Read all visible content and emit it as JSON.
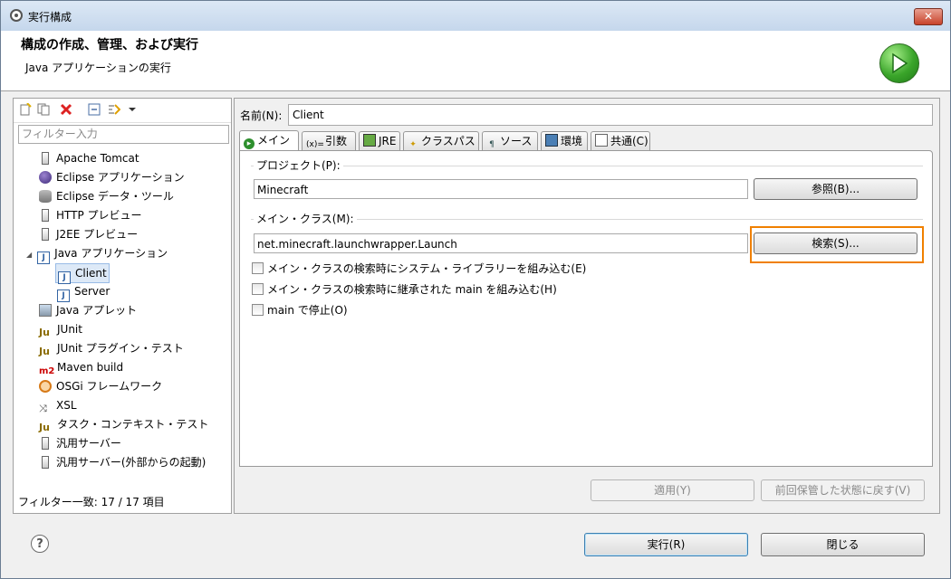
{
  "window": {
    "title": "実行構成",
    "close_label": "✕"
  },
  "header": {
    "title": "構成の作成、管理、および実行",
    "subtitle": "Java アプリケーションの実行"
  },
  "left": {
    "filter_placeholder": "フィルター入力",
    "tree": [
      {
        "label": "Apache Tomcat",
        "icon": "server-icon"
      },
      {
        "label": "Eclipse アプリケーション",
        "icon": "eclipse-icon"
      },
      {
        "label": "Eclipse データ・ツール",
        "icon": "database-icon"
      },
      {
        "label": "HTTP プレビュー",
        "icon": "server-icon"
      },
      {
        "label": "J2EE プレビュー",
        "icon": "server-icon"
      },
      {
        "label": "Java アプリケーション",
        "icon": "java-app-icon"
      },
      {
        "label": "Client",
        "icon": "java-app-icon"
      },
      {
        "label": "Server",
        "icon": "java-app-icon"
      },
      {
        "label": "Java アプレット",
        "icon": "applet-icon"
      },
      {
        "label": "JUnit",
        "icon": "junit-icon"
      },
      {
        "label": "JUnit プラグイン・テスト",
        "icon": "junit-plugin-icon"
      },
      {
        "label": "Maven build",
        "icon": "maven-icon"
      },
      {
        "label": "OSGi フレームワーク",
        "icon": "osgi-icon"
      },
      {
        "label": "XSL",
        "icon": "xsl-icon"
      },
      {
        "label": "タスク・コンテキスト・テスト",
        "icon": "task-context-icon"
      },
      {
        "label": "汎用サーバー",
        "icon": "server-icon"
      },
      {
        "label": "汎用サーバー(外部からの起動)",
        "icon": "server-icon"
      }
    ],
    "filter_status": "フィルター一致: 17 / 17 項目"
  },
  "main": {
    "name_label": "名前(N):",
    "name_value": "Client",
    "tabs": [
      {
        "label": "メイン",
        "icon": "main-tab-icon"
      },
      {
        "label": "引数",
        "icon": "arguments-icon"
      },
      {
        "label": "JRE",
        "icon": "jre-icon"
      },
      {
        "label": "クラスパス",
        "icon": "classpath-icon"
      },
      {
        "label": "ソース",
        "icon": "source-icon"
      },
      {
        "label": "環境",
        "icon": "environment-icon"
      },
      {
        "label": "共通(C)",
        "icon": "common-icon"
      }
    ],
    "project_group": "プロジェクト(P):",
    "project_value": "Minecraft",
    "browse_label": "参照(B)...",
    "main_class_group": "メイン・クラス(M):",
    "main_class_value": "net.minecraft.launchwrapper.Launch",
    "search_label": "検索(S)...",
    "checks": [
      {
        "label": "メイン・クラスの検索時にシステム・ライブラリーを組み込む(E)",
        "checked": false
      },
      {
        "label": "メイン・クラスの検索時に継承された main を組み込む(H)",
        "checked": false
      },
      {
        "label": "main で停止(O)",
        "checked": false
      }
    ],
    "apply_label": "適用(Y)",
    "revert_label": "前回保管した状態に戻す(V)"
  },
  "footer": {
    "help_label": "?",
    "run_label": "実行(R)",
    "close_label": "閉じる"
  },
  "colors": {
    "highlight": "#f08000",
    "title_bar": "#c5d7ec"
  }
}
